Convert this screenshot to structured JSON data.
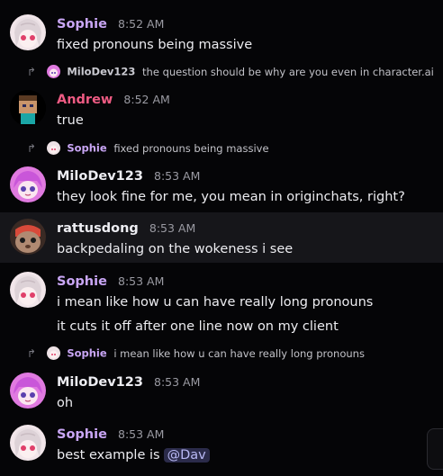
{
  "colors": {
    "sophie": "#c9a6f5",
    "andrew": "#ee5b83",
    "milodev": "#ededf2",
    "rattusdong": "#ededf2"
  },
  "messages": [
    {
      "author": "Sophie",
      "time": "8:52 AM",
      "lines": [
        "fixed pronouns being massive"
      ]
    },
    {
      "reply_author": "MiloDev123",
      "reply_text": "the question should be why are you even in character.ai"
    },
    {
      "author": "Andrew",
      "time": "8:52 AM",
      "lines": [
        "true"
      ]
    },
    {
      "reply_author": "Sophie",
      "reply_text": "fixed pronouns being massive"
    },
    {
      "author": "MiloDev123",
      "time": "8:53 AM",
      "lines": [
        "they look fine for me, you mean in originchats, right?"
      ]
    },
    {
      "author": "rattusdong",
      "time": "8:53 AM",
      "lines": [
        "backpedaling on the wokeness i see"
      ]
    },
    {
      "author": "Sophie",
      "time": "8:53 AM",
      "lines": [
        "i mean like how u can have really long pronouns",
        "it cuts it off after one line now on my client"
      ]
    },
    {
      "reply_author": "Sophie",
      "reply_text": "i mean like how u can have really long pronouns"
    },
    {
      "author": "MiloDev123",
      "time": "8:53 AM",
      "lines": [
        "oh"
      ]
    },
    {
      "author": "Sophie",
      "time": "8:53 AM",
      "lines": [
        "best example is"
      ],
      "mention": "@Dav"
    }
  ],
  "icons": {
    "reply": "reply-arrow-icon",
    "scroll": "scroll-button"
  }
}
